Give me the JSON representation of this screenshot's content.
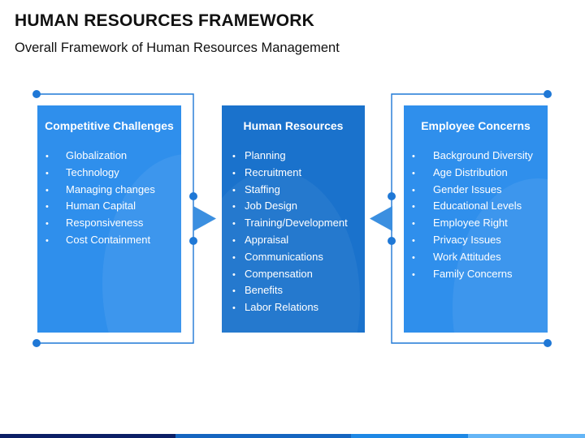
{
  "header": {
    "title": "HUMAN RESOURCES FRAMEWORK",
    "subtitle": "Overall Framework of Human Resources Management"
  },
  "panels": {
    "left": {
      "heading": "Competitive Challenges",
      "items": [
        "Globalization",
        "Technology",
        "Managing changes",
        "Human Capital",
        "Responsiveness",
        "Cost Containment"
      ]
    },
    "center": {
      "heading": "Human Resources",
      "items": [
        "Planning",
        "Recruitment",
        "Staffing",
        "Job Design",
        "Training/Development",
        "Appraisal",
        "Communications",
        "Compensation",
        "Benefits",
        "Labor Relations"
      ]
    },
    "right": {
      "heading": "Employee Concerns",
      "items": [
        "Background Diversity",
        "Age Distribution",
        "Gender Issues",
        "Educational Levels",
        "Employee Right",
        "Privacy Issues",
        "Work Attitudes",
        "Family Concerns"
      ]
    }
  },
  "bullet_glyph": "•",
  "colors": {
    "side_panel": "#2f8fec",
    "center_panel": "#1a72cc",
    "connector": "#1f78d6",
    "arrow": "#3b8fe0",
    "bottom_bar": [
      "#0b1f66",
      "#1565c0",
      "#1e88e5",
      "#64b5f6"
    ]
  }
}
